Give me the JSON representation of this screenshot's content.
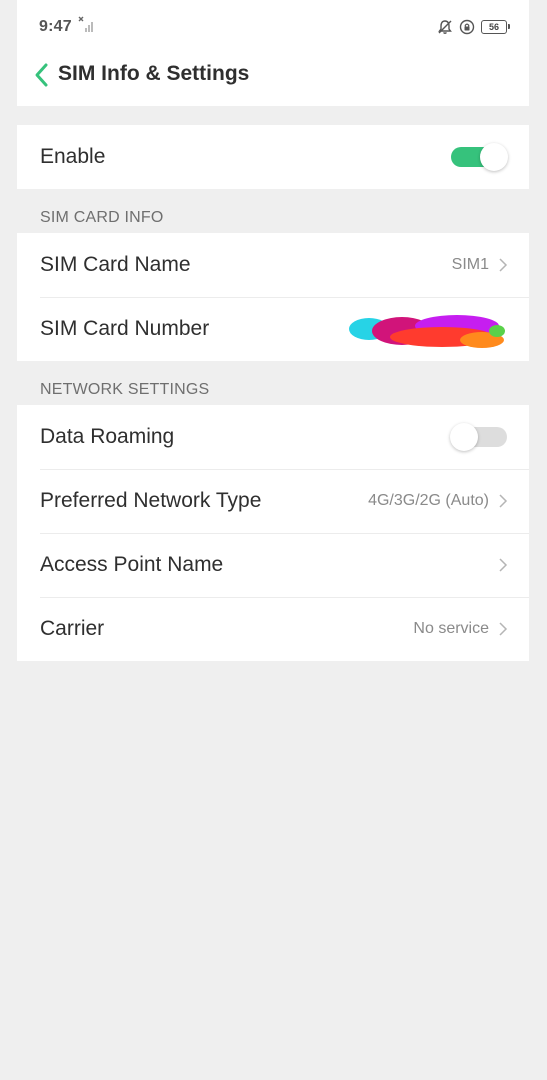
{
  "status_bar": {
    "time": "9:47",
    "battery_level": "56",
    "icons": [
      "signal-off-icon",
      "silent-bell-icon",
      "rotation-lock-icon",
      "battery-icon"
    ]
  },
  "header": {
    "title": "SIM Info & Settings",
    "back_icon": "chevron-left-icon"
  },
  "enable_row": {
    "label": "Enable",
    "toggle_on": true
  },
  "sim_card_info": {
    "section_title": "SIM CARD INFO",
    "rows": [
      {
        "label": "SIM Card Name",
        "value": "SIM1"
      },
      {
        "label": "SIM Card Number",
        "value": ""
      }
    ]
  },
  "network_settings": {
    "section_title": "NETWORK SETTINGS",
    "rows": [
      {
        "label": "Data Roaming",
        "toggle_on": false
      },
      {
        "label": "Preferred Network Type",
        "value": "4G/3G/2G (Auto)"
      },
      {
        "label": "Access Point Name",
        "value": ""
      },
      {
        "label": "Carrier",
        "value": "No service"
      }
    ]
  },
  "colors": {
    "accent": "#36c27c",
    "background": "#efefef",
    "card": "#ffffff",
    "secondary_text": "#8a8a8a"
  }
}
